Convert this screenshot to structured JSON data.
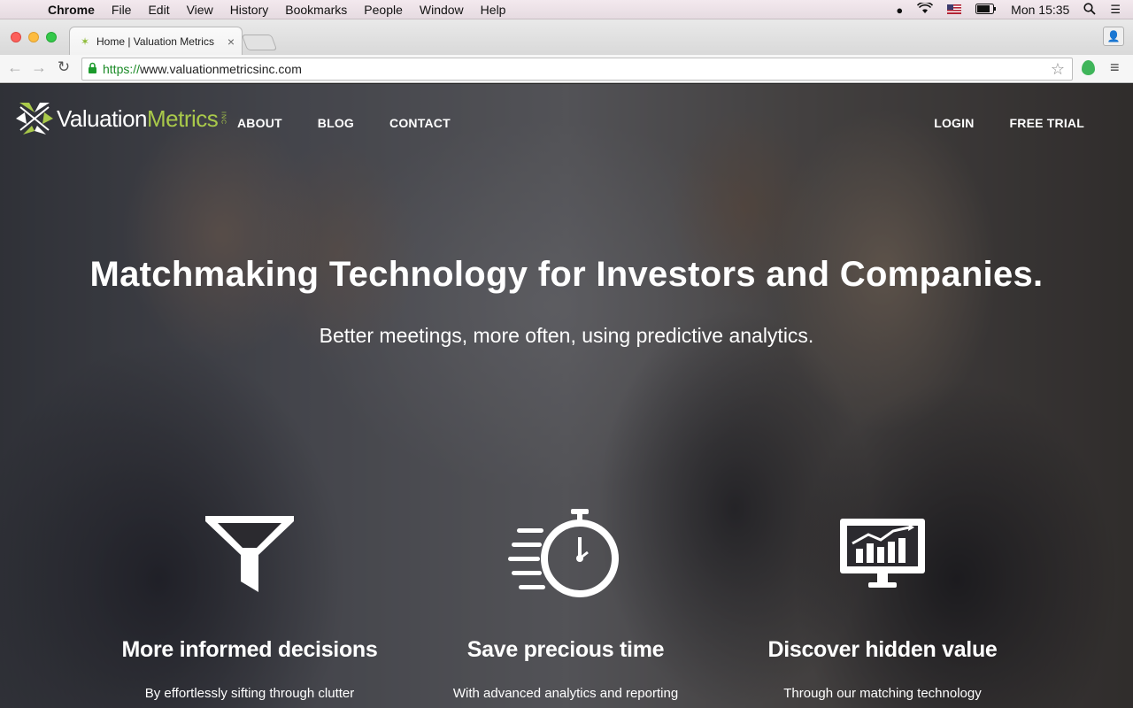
{
  "menubar": {
    "app": "Chrome",
    "items": [
      "File",
      "Edit",
      "View",
      "History",
      "Bookmarks",
      "People",
      "Window",
      "Help"
    ],
    "clock": "Mon 15:35"
  },
  "browser": {
    "tab_title": "Home | Valuation Metrics",
    "url_scheme": "https://",
    "url_rest": "www.valuationmetricsinc.com"
  },
  "site": {
    "logo": {
      "valuation": "Valuation",
      "metrics": "Metrics",
      "inc": "INC"
    },
    "nav": {
      "about": "ABOUT",
      "blog": "BLOG",
      "contact": "CONTACT",
      "login": "LOGIN",
      "free_trial": "FREE TRIAL"
    },
    "hero": {
      "title": "Matchmaking Technology for Investors and Companies.",
      "subtitle": "Better meetings, more often, using predictive analytics."
    },
    "features": [
      {
        "title": "More informed decisions",
        "text": "By effortlessly sifting through clutter",
        "icon": "funnel-icon"
      },
      {
        "title": "Save precious time",
        "text": "With advanced analytics and reporting",
        "icon": "stopwatch-icon"
      },
      {
        "title": "Discover hidden value",
        "text": "Through our matching technology",
        "icon": "monitor-chart-icon"
      }
    ]
  },
  "colors": {
    "brand_green": "#a9c94a",
    "url_green": "#1a8a26"
  }
}
